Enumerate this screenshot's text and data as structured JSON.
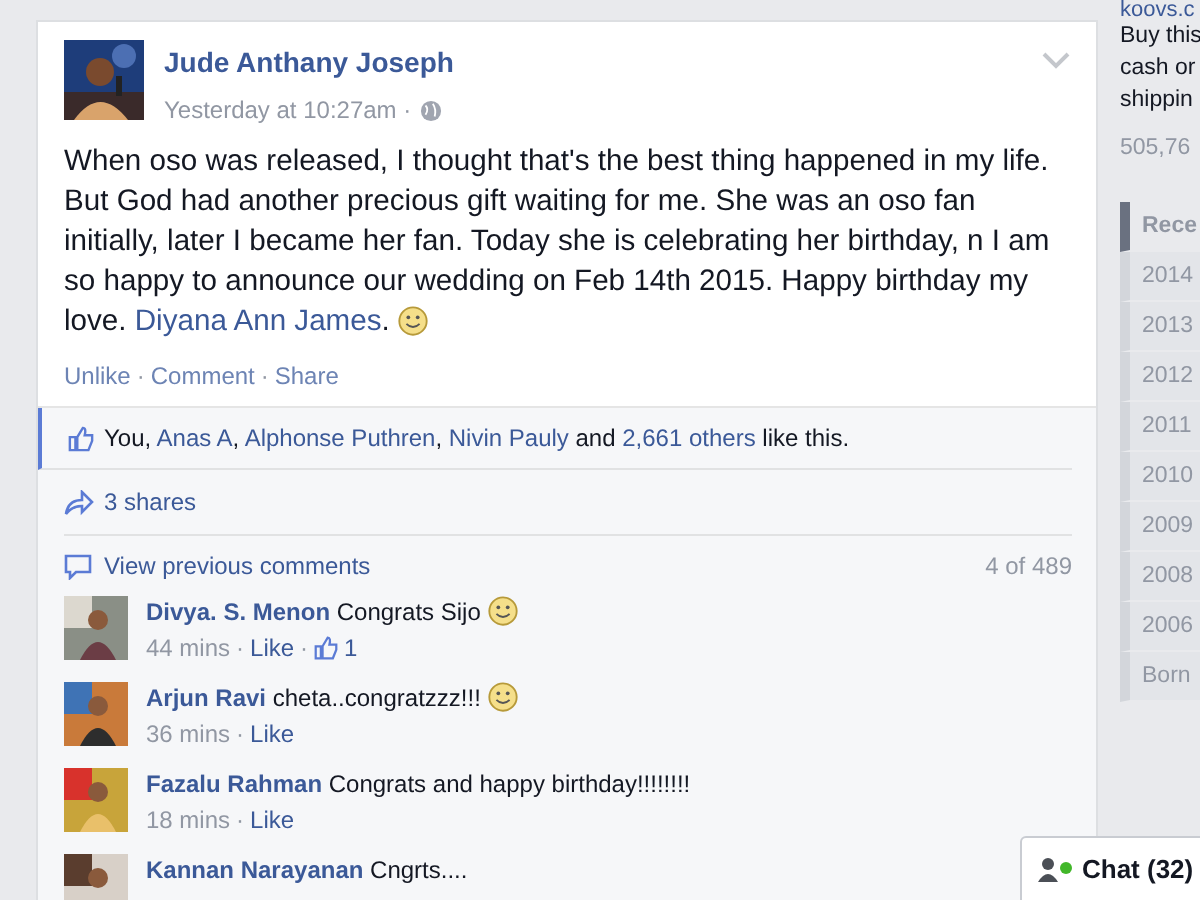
{
  "post": {
    "author": "Jude Anthany Joseph",
    "time": "Yesterday at 10:27am ·",
    "body": [
      {
        "kind": "text",
        "text": "When oso was released, I thought that's the best thing happened in my life. But God had another precious gift waiting for me. She was an oso fan initially, later I became her fan. Today she is celebrating her birthday, n I am so happy to announce our wedding on Feb 14th 2015. Happy birthday my love. "
      },
      {
        "kind": "link",
        "text": "Diyana Ann James"
      },
      {
        "kind": "text",
        "text": "."
      }
    ],
    "emoji": true,
    "separator": "·",
    "actions": [
      "Unlike",
      "Comment",
      "Share"
    ]
  },
  "likes": [
    {
      "kind": "text",
      "text": "You, "
    },
    {
      "kind": "link",
      "text": "Anas A"
    },
    {
      "kind": "text",
      "text": ", "
    },
    {
      "kind": "link",
      "text": "Alphonse Puthren"
    },
    {
      "kind": "text",
      "text": ", "
    },
    {
      "kind": "link",
      "text": "Nivin Pauly"
    },
    {
      "kind": "text",
      "text": " and "
    },
    {
      "kind": "link",
      "text": "2,661 others"
    },
    {
      "kind": "text",
      "text": " like this."
    }
  ],
  "shares": "3 shares",
  "comments_header": {
    "label": "View previous comments",
    "count": "4 of 489"
  },
  "comments": [
    {
      "author": "Divya. S. Menon",
      "text": "Congrats Sijo",
      "emoji": true,
      "time": "44 mins",
      "separator": "·",
      "action": "Like",
      "like_separator": "·",
      "like_count": "1"
    },
    {
      "author": "Arjun Ravi",
      "text": "cheta..congratzzz!!!",
      "emoji": true,
      "time": "36 mins",
      "separator": "·",
      "action": "Like"
    },
    {
      "author": "Fazalu Rahman",
      "text": "Congrats and happy birthday!!!!!!!!",
      "emoji": false,
      "time": "18 mins",
      "separator": "·",
      "action": "Like"
    },
    {
      "author": "Kannan Narayanan",
      "text": "Cngrts....",
      "emoji": false
    }
  ],
  "sidebar": {
    "ad_lines": [
      "koovs.c",
      "Buy this",
      "cash or",
      "shippin"
    ],
    "stat": "505,76",
    "timeline": [
      {
        "label": "Rece",
        "selected": true
      },
      {
        "label": "2014",
        "selected": false
      },
      {
        "label": "2013",
        "selected": false
      },
      {
        "label": "2012",
        "selected": false
      },
      {
        "label": "2011",
        "selected": false
      },
      {
        "label": "2010",
        "selected": false
      },
      {
        "label": "2009",
        "selected": false
      },
      {
        "label": "2008",
        "selected": false
      },
      {
        "label": "2006",
        "selected": false
      },
      {
        "label": "Born",
        "selected": false
      }
    ]
  },
  "chat": {
    "label": "Chat (32)",
    "online": true
  }
}
